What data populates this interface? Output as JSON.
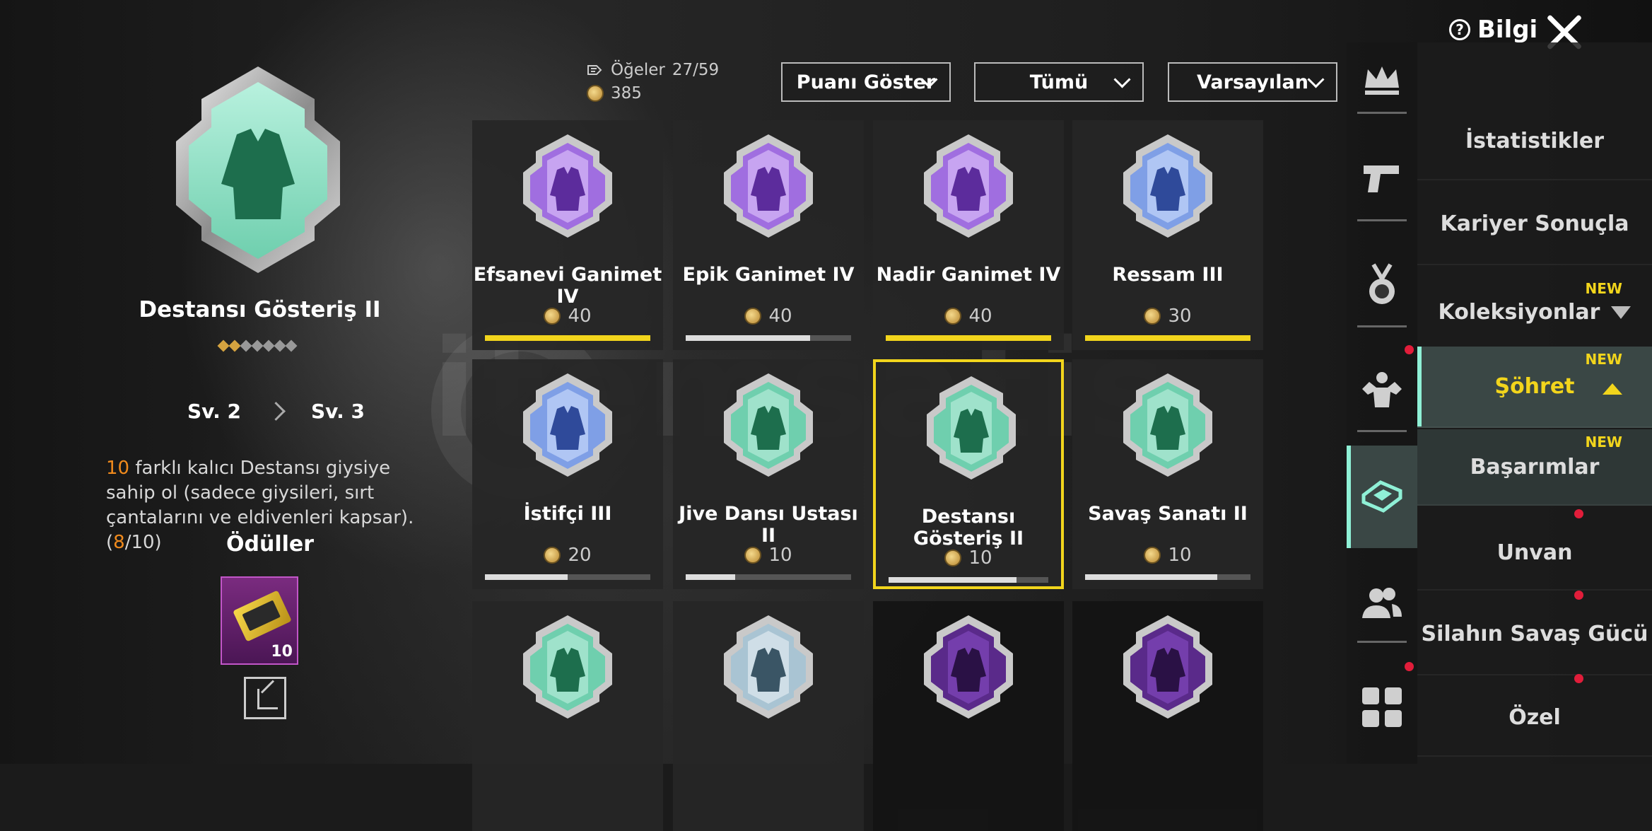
{
  "header": {
    "help_label": "Bilgi"
  },
  "selected": {
    "title": "Destansı Gösteriş II",
    "level_from": "Sv. 2",
    "level_to": "Sv. 3",
    "stars_total": 7,
    "stars_filled": 2,
    "desc_count": "10",
    "desc_text": " farklı kalıcı Destansı giysiye sahip ol (sadece giysileri, sırt çantalarını ve eldivenleri kapsar). (",
    "desc_progress": "8",
    "desc_total": "/10)",
    "rewards_label": "Ödüller",
    "reward_count": "10"
  },
  "stats": {
    "items_label": "Öğeler",
    "items_value": "27/59",
    "points_value": "385"
  },
  "filters": [
    {
      "label": "Puanı Göster"
    },
    {
      "label": "Tümü"
    },
    {
      "label": "Varsayılan"
    }
  ],
  "cards": [
    {
      "name": "Efsanevi Ganimet IV",
      "points": "40",
      "progress": 1.0,
      "style": "purple",
      "bar": "gold"
    },
    {
      "name": "Epik Ganimet IV",
      "points": "40",
      "progress": 0.75,
      "style": "purple",
      "bar": "grey"
    },
    {
      "name": "Nadir Ganimet IV",
      "points": "40",
      "progress": 1.0,
      "style": "purple",
      "bar": "gold"
    },
    {
      "name": "Ressam III",
      "points": "30",
      "progress": 1.0,
      "style": "blue",
      "bar": "gold"
    },
    {
      "name": "İstifçi III",
      "points": "20",
      "progress": 0.5,
      "style": "blue",
      "bar": "grey"
    },
    {
      "name": "Jive Dansı Ustası II",
      "points": "10",
      "progress": 0.3,
      "style": "green",
      "bar": "grey"
    },
    {
      "name": "Destansı Gösteriş II",
      "points": "10",
      "progress": 0.8,
      "style": "green",
      "bar": "grey"
    },
    {
      "name": "Savaş Sanatı II",
      "points": "10",
      "progress": 0.8,
      "style": "green",
      "bar": "grey"
    },
    {
      "name": "",
      "points": "",
      "progress": null,
      "style": "green",
      "bar": "none"
    },
    {
      "name": "",
      "points": "",
      "progress": null,
      "style": "silver",
      "bar": "none"
    },
    {
      "name": "",
      "points": "",
      "progress": null,
      "style": "darkpurple",
      "bar": "none"
    },
    {
      "name": "",
      "points": "",
      "progress": null,
      "style": "darkpurple",
      "bar": "none"
    }
  ],
  "menu": [
    {
      "label": "İstatistikler"
    },
    {
      "label": "Kariyer Sonuçla"
    },
    {
      "label": "Koleksiyonlar",
      "new": "NEW"
    },
    {
      "label": "Şöhret",
      "new": "NEW"
    },
    {
      "label": "Başarımlar",
      "new": "NEW"
    },
    {
      "label": "Unvan"
    },
    {
      "label": "Silahın Savaş Gücü"
    },
    {
      "label": "Özel"
    }
  ],
  "icons": [
    "crown-icon",
    "pistol-icon",
    "medal-icon",
    "muscle-icon",
    "fame-icon",
    "friends-icon",
    "grid-icon"
  ],
  "colors": {
    "accent": "#f2d51c",
    "active_tab": "#8ff0d6",
    "notify": "#e11d3a"
  }
}
